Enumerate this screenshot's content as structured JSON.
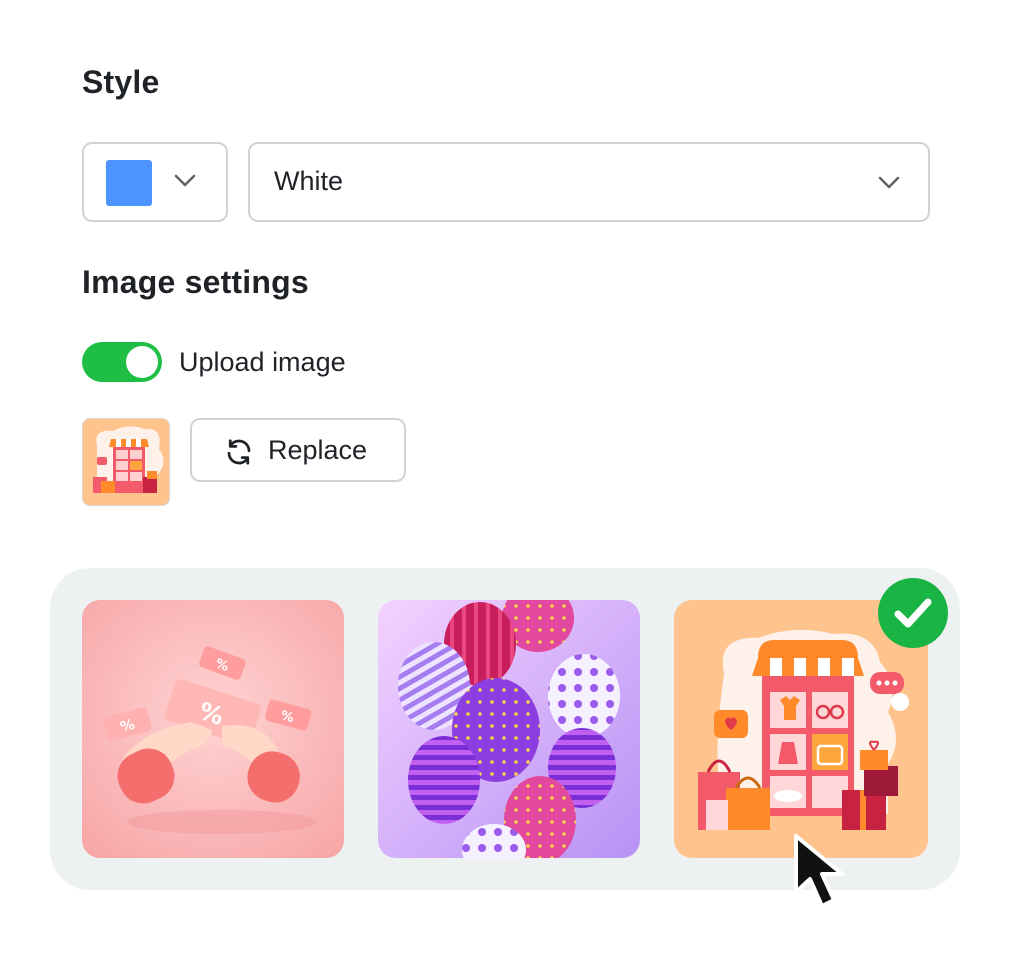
{
  "style": {
    "heading": "Style",
    "color_select": {
      "swatch_color": "#4d94ff",
      "icon": "chevron-down-icon"
    },
    "theme_select": {
      "value": "White",
      "icon": "chevron-down-icon"
    }
  },
  "image_settings": {
    "heading": "Image settings",
    "upload_toggle": {
      "label": "Upload image",
      "on": true,
      "color": "#1fbf46"
    },
    "replace_button": {
      "label": "Replace",
      "icon": "refresh-icon"
    }
  },
  "gallery": {
    "items": [
      {
        "name": "coupon-hands-image",
        "selected": false
      },
      {
        "name": "balloons-image",
        "selected": false
      },
      {
        "name": "online-shop-image",
        "selected": true
      }
    ],
    "selected_badge_color": "#19b443"
  }
}
